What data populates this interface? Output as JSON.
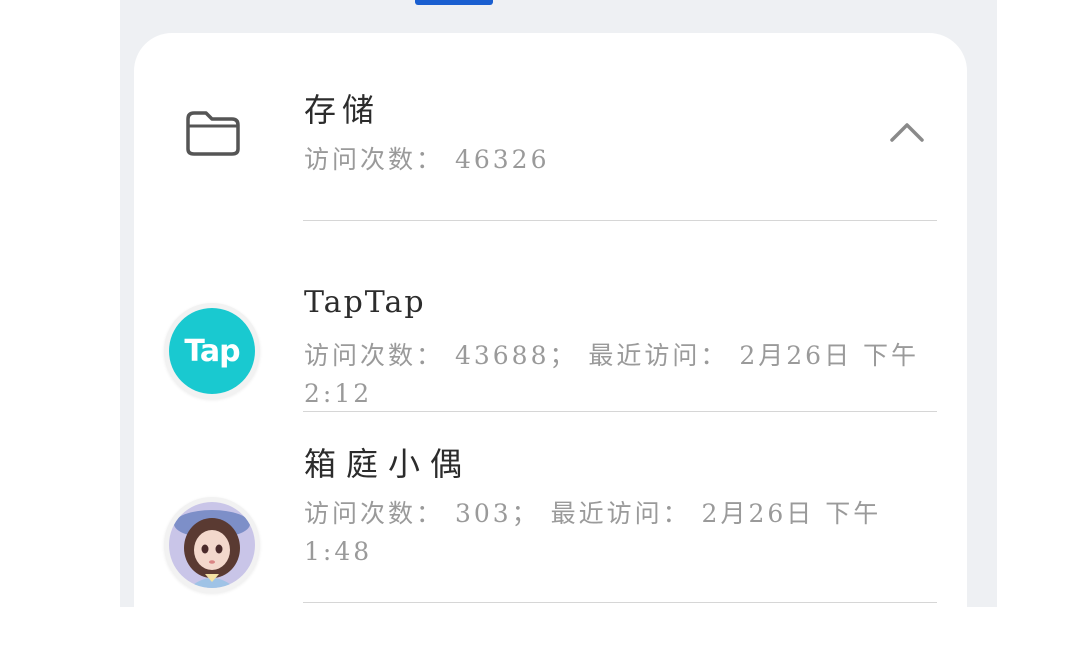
{
  "items": [
    {
      "name": "存储",
      "subtitle": "访问次数： 46326",
      "icon": "folder-icon",
      "expand_icon": "chevron-up-icon"
    },
    {
      "name": "TapTap",
      "subtitle": "访问次数： 43688； 最近访问： 2月26日 下午2:12",
      "icon": "taptap-app-icon",
      "icon_text": "Tap",
      "icon_color": "#19c9d0"
    },
    {
      "name": "箱庭小偶",
      "subtitle": "访问次数： 303； 最近访问： 2月26日 下午1:48",
      "icon": "doll-avatar-icon"
    }
  ],
  "colors": {
    "accent": "#1a5fd0",
    "background": "#eef0f3",
    "card": "#ffffff",
    "title_text": "#2c2c2c",
    "secondary_text": "#9a9a9a",
    "divider": "#d6d6d6"
  }
}
